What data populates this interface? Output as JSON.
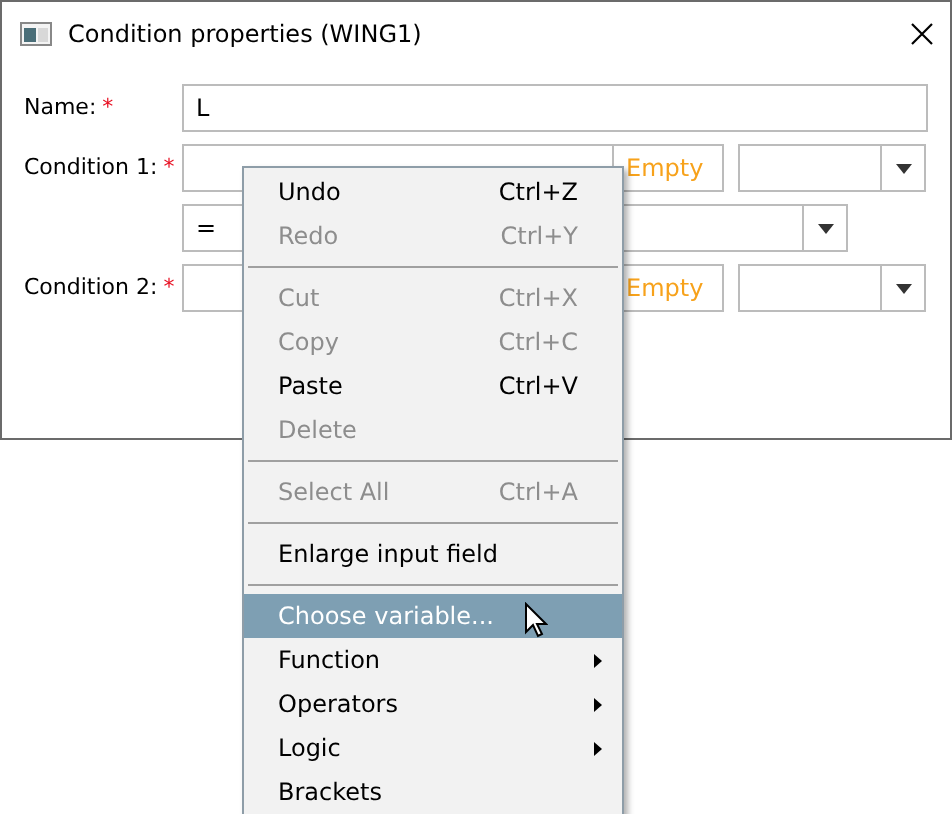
{
  "window": {
    "title": "Condition properties (WING1)"
  },
  "name_row": {
    "label": "Name:",
    "required_mark": "*",
    "value": "L"
  },
  "conditions": [
    {
      "label": "Condition 1:",
      "required_mark": "*",
      "value_hint": "Empty",
      "operator": "="
    },
    {
      "label": "Condition 2:",
      "required_mark": "*",
      "value_hint": "Empty"
    }
  ],
  "context_menu": [
    {
      "kind": "item",
      "label": "Undo",
      "shortcut": "Ctrl+Z",
      "disabled": false,
      "selected": false,
      "submenu": false
    },
    {
      "kind": "item",
      "label": "Redo",
      "shortcut": "Ctrl+Y",
      "disabled": true,
      "selected": false,
      "submenu": false
    },
    {
      "kind": "separator"
    },
    {
      "kind": "item",
      "label": "Cut",
      "shortcut": "Ctrl+X",
      "disabled": true,
      "selected": false,
      "submenu": false
    },
    {
      "kind": "item",
      "label": "Copy",
      "shortcut": "Ctrl+C",
      "disabled": true,
      "selected": false,
      "submenu": false
    },
    {
      "kind": "item",
      "label": "Paste",
      "shortcut": "Ctrl+V",
      "disabled": false,
      "selected": false,
      "submenu": false
    },
    {
      "kind": "item",
      "label": "Delete",
      "disabled": true,
      "selected": false,
      "submenu": false
    },
    {
      "kind": "separator"
    },
    {
      "kind": "item",
      "label": "Select All",
      "shortcut": "Ctrl+A",
      "disabled": true,
      "selected": false,
      "submenu": false
    },
    {
      "kind": "separator"
    },
    {
      "kind": "item",
      "label": "Enlarge input field",
      "disabled": false,
      "selected": false,
      "submenu": false
    },
    {
      "kind": "separator"
    },
    {
      "kind": "item",
      "label": "Choose variable...",
      "disabled": false,
      "selected": true,
      "submenu": false
    },
    {
      "kind": "item",
      "label": "Function",
      "disabled": false,
      "selected": false,
      "submenu": true
    },
    {
      "kind": "item",
      "label": "Operators",
      "disabled": false,
      "selected": false,
      "submenu": true
    },
    {
      "kind": "item",
      "label": "Logic",
      "disabled": false,
      "selected": false,
      "submenu": true
    },
    {
      "kind": "item",
      "label": "Brackets",
      "disabled": false,
      "selected": false,
      "submenu": false
    }
  ]
}
